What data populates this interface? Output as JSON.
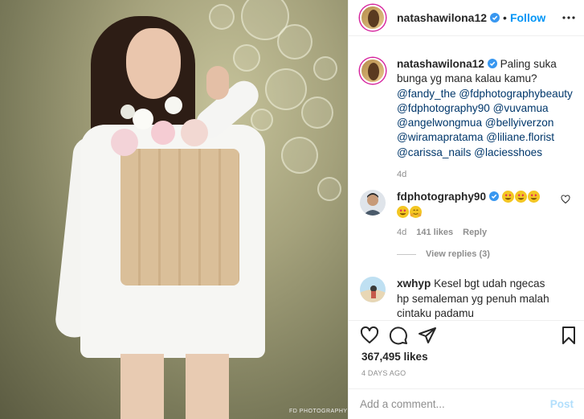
{
  "photo": {
    "credit": "FD PHOTOGRAPHY"
  },
  "header": {
    "username": "natashawilona12",
    "separator": "•",
    "follow_label": "Follow",
    "verified_icon": "verified-badge-icon",
    "more_icon": "more-dots-icon"
  },
  "caption": {
    "username": "natashawilona12",
    "text": "Paling suka bunga yg mana kalau kamu?",
    "mentions": [
      "@fandy_the",
      "@fdphotographybeauty",
      "@fdphotography90",
      "@vuvamua",
      "@angelwongmua",
      "@bellyiverzon",
      "@wiramapratama",
      "@liliane.florist",
      "@carissa_nails",
      "@laciesshoes"
    ],
    "time": "4d"
  },
  "comments": [
    {
      "username": "fdphotography90",
      "verified": true,
      "emoji": [
        "heart-eyes",
        "heart-eyes",
        "heart-eyes",
        "heart-eyes",
        "hug"
      ],
      "time": "4d",
      "likes": "141 likes",
      "reply_label": "Reply",
      "view_replies": "View replies (3)"
    },
    {
      "username": "xwhyp",
      "text": "Kesel bgt udah ngecas hp semaleman yg penuh malah cintaku padamu"
    }
  ],
  "actions": {
    "like_icon": "heart-outline-icon",
    "comment_icon": "comment-bubble-icon",
    "share_icon": "paper-plane-icon",
    "save_icon": "bookmark-icon"
  },
  "likes_count": "367,495 likes",
  "post_date": "4 DAYS AGO",
  "add_comment": {
    "placeholder": "Add a comment...",
    "post_label": "Post"
  },
  "colors": {
    "link": "#0095f6",
    "mention": "#00376b",
    "muted": "#8e8e8e",
    "emoji_heart_eyes": "#f3c623",
    "post_disabled": "#b2dffc"
  }
}
